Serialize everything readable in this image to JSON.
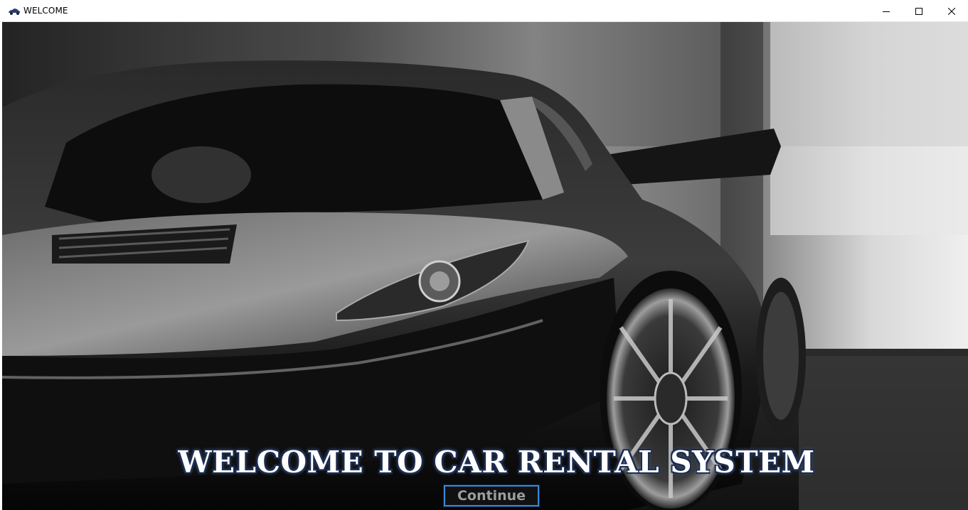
{
  "window": {
    "title": "WELCOME",
    "icon": "car-icon",
    "controls": [
      "minimize-icon",
      "maximize-icon",
      "close-icon"
    ]
  },
  "main": {
    "background_image": "black sports car photograph (grayscale)",
    "heading": "Welcome to Car Rental System",
    "continue_label": "Continue"
  },
  "colors": {
    "heading_fill": "#ffffff",
    "heading_outline": "#1d2d52",
    "button_border": "#3b86d6",
    "button_text": "#9d9d9d",
    "button_bg": "#111111"
  }
}
